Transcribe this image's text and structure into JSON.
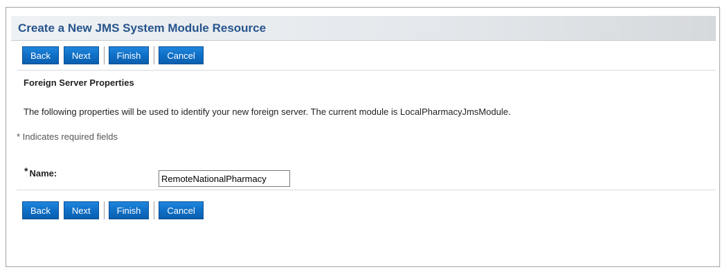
{
  "header": {
    "title": "Create a New JMS System Module Resource"
  },
  "buttons": {
    "back": "Back",
    "next": "Next",
    "finish": "Finish",
    "cancel": "Cancel"
  },
  "section": {
    "title": "Foreign Server Properties",
    "description": "The following properties will be used to identify your new foreign server. The current module is LocalPharmacyJmsModule.",
    "required_note": "* Indicates required fields"
  },
  "form": {
    "name_label": "Name:",
    "required_star": "*",
    "name_value": "RemoteNationalPharmacy"
  },
  "colors": {
    "button_blue": "#0f6fc6",
    "header_title": "#26548c"
  }
}
